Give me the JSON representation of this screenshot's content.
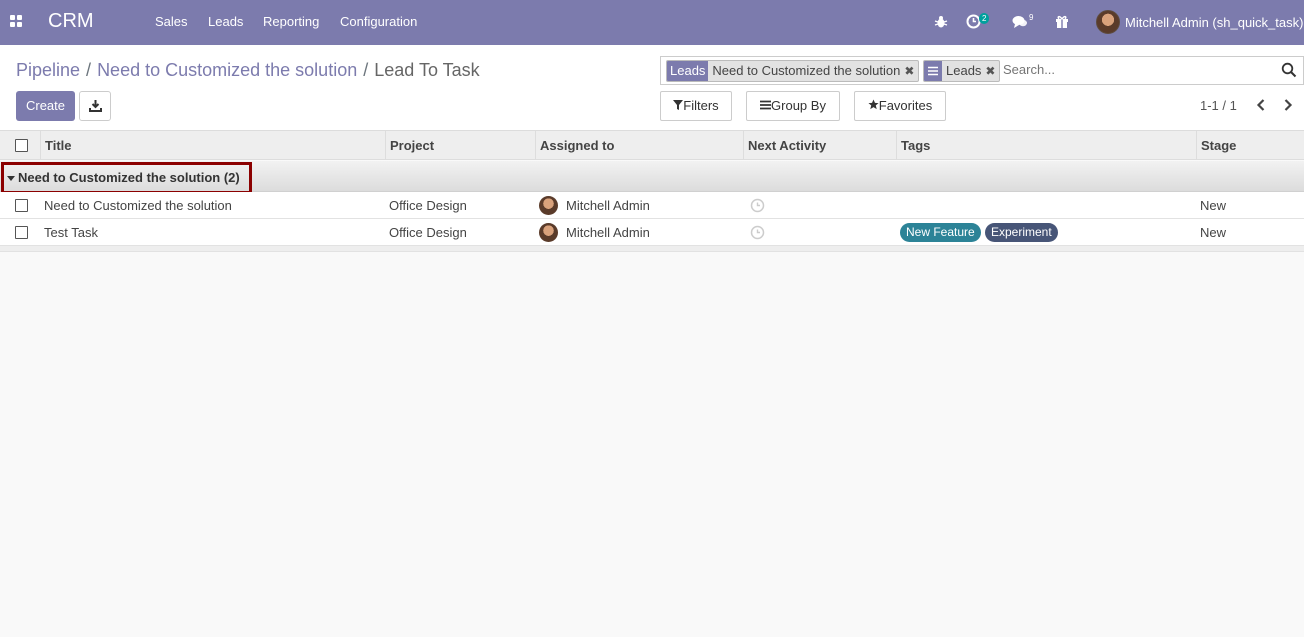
{
  "navbar": {
    "brand": "CRM",
    "menus": [
      "Sales",
      "Leads",
      "Reporting",
      "Configuration"
    ],
    "activity_count": "2",
    "message_count": "9",
    "user_name": "Mitchell Admin (sh_quick_task)"
  },
  "breadcrumb": {
    "items": [
      "Pipeline",
      "Need to Customized the solution"
    ],
    "current": "Lead To Task"
  },
  "actions": {
    "create_label": "Create"
  },
  "search": {
    "facets": [
      {
        "label": "Leads",
        "value": "Need to Customized the solution"
      },
      {
        "label": "group-icon",
        "value": "Leads"
      }
    ],
    "placeholder": "Search..."
  },
  "filters": {
    "filters_label": "Filters",
    "groupby_label": "Group By",
    "favorites_label": "Favorites"
  },
  "pager": {
    "value": "1-1 / 1"
  },
  "table": {
    "columns": [
      "Title",
      "Project",
      "Assigned to",
      "Next Activity",
      "Tags",
      "Stage"
    ],
    "group": {
      "label": "Need to Customized the solution (2)"
    },
    "rows": [
      {
        "title": "Need to Customized the solution",
        "project": "Office Design",
        "assigned": "Mitchell Admin",
        "tags": [],
        "stage": "New"
      },
      {
        "title": "Test Task",
        "project": "Office Design",
        "assigned": "Mitchell Admin",
        "tags": [
          "New Feature",
          "Experiment"
        ],
        "stage": "New"
      }
    ]
  },
  "colors": {
    "navbar": "#7c7bad",
    "tag_new_feature": "#2c8397",
    "tag_experiment": "#475577",
    "group_highlight": "#8b0000"
  }
}
